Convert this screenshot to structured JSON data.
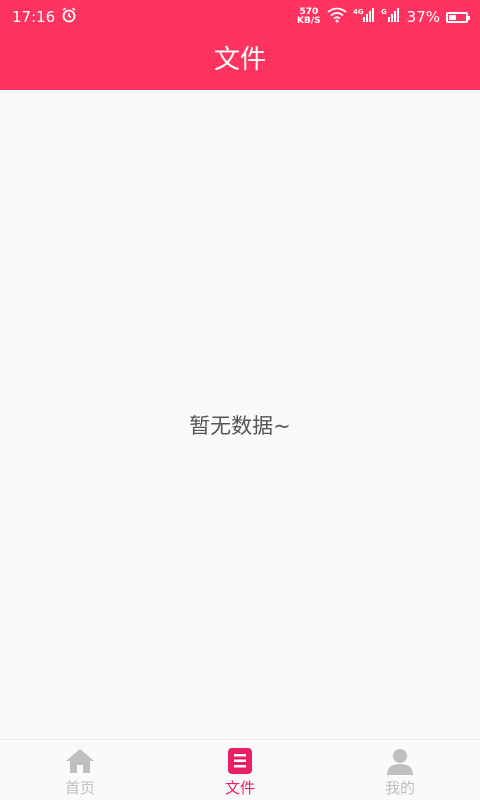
{
  "status_bar": {
    "time": "17:16",
    "net_speed_value": "570",
    "net_speed_unit": "KB/S",
    "battery_percent": "37%",
    "battery_level": 0.37,
    "icons": [
      "alarm-icon",
      "wifi-icon",
      "signal-4g-icon",
      "signal-g-icon",
      "battery-icon"
    ]
  },
  "header": {
    "title": "文件"
  },
  "main": {
    "empty_message": "暂无数据~"
  },
  "tabbar": {
    "items": [
      {
        "label": "首页",
        "icon": "home-icon",
        "active": false
      },
      {
        "label": "文件",
        "icon": "file-list-icon",
        "active": true
      },
      {
        "label": "我的",
        "icon": "profile-icon",
        "active": false
      }
    ]
  },
  "colors": {
    "accent": "#ff3360",
    "active_tab": "#e91e63",
    "inactive_tab": "#bfbfbf"
  }
}
